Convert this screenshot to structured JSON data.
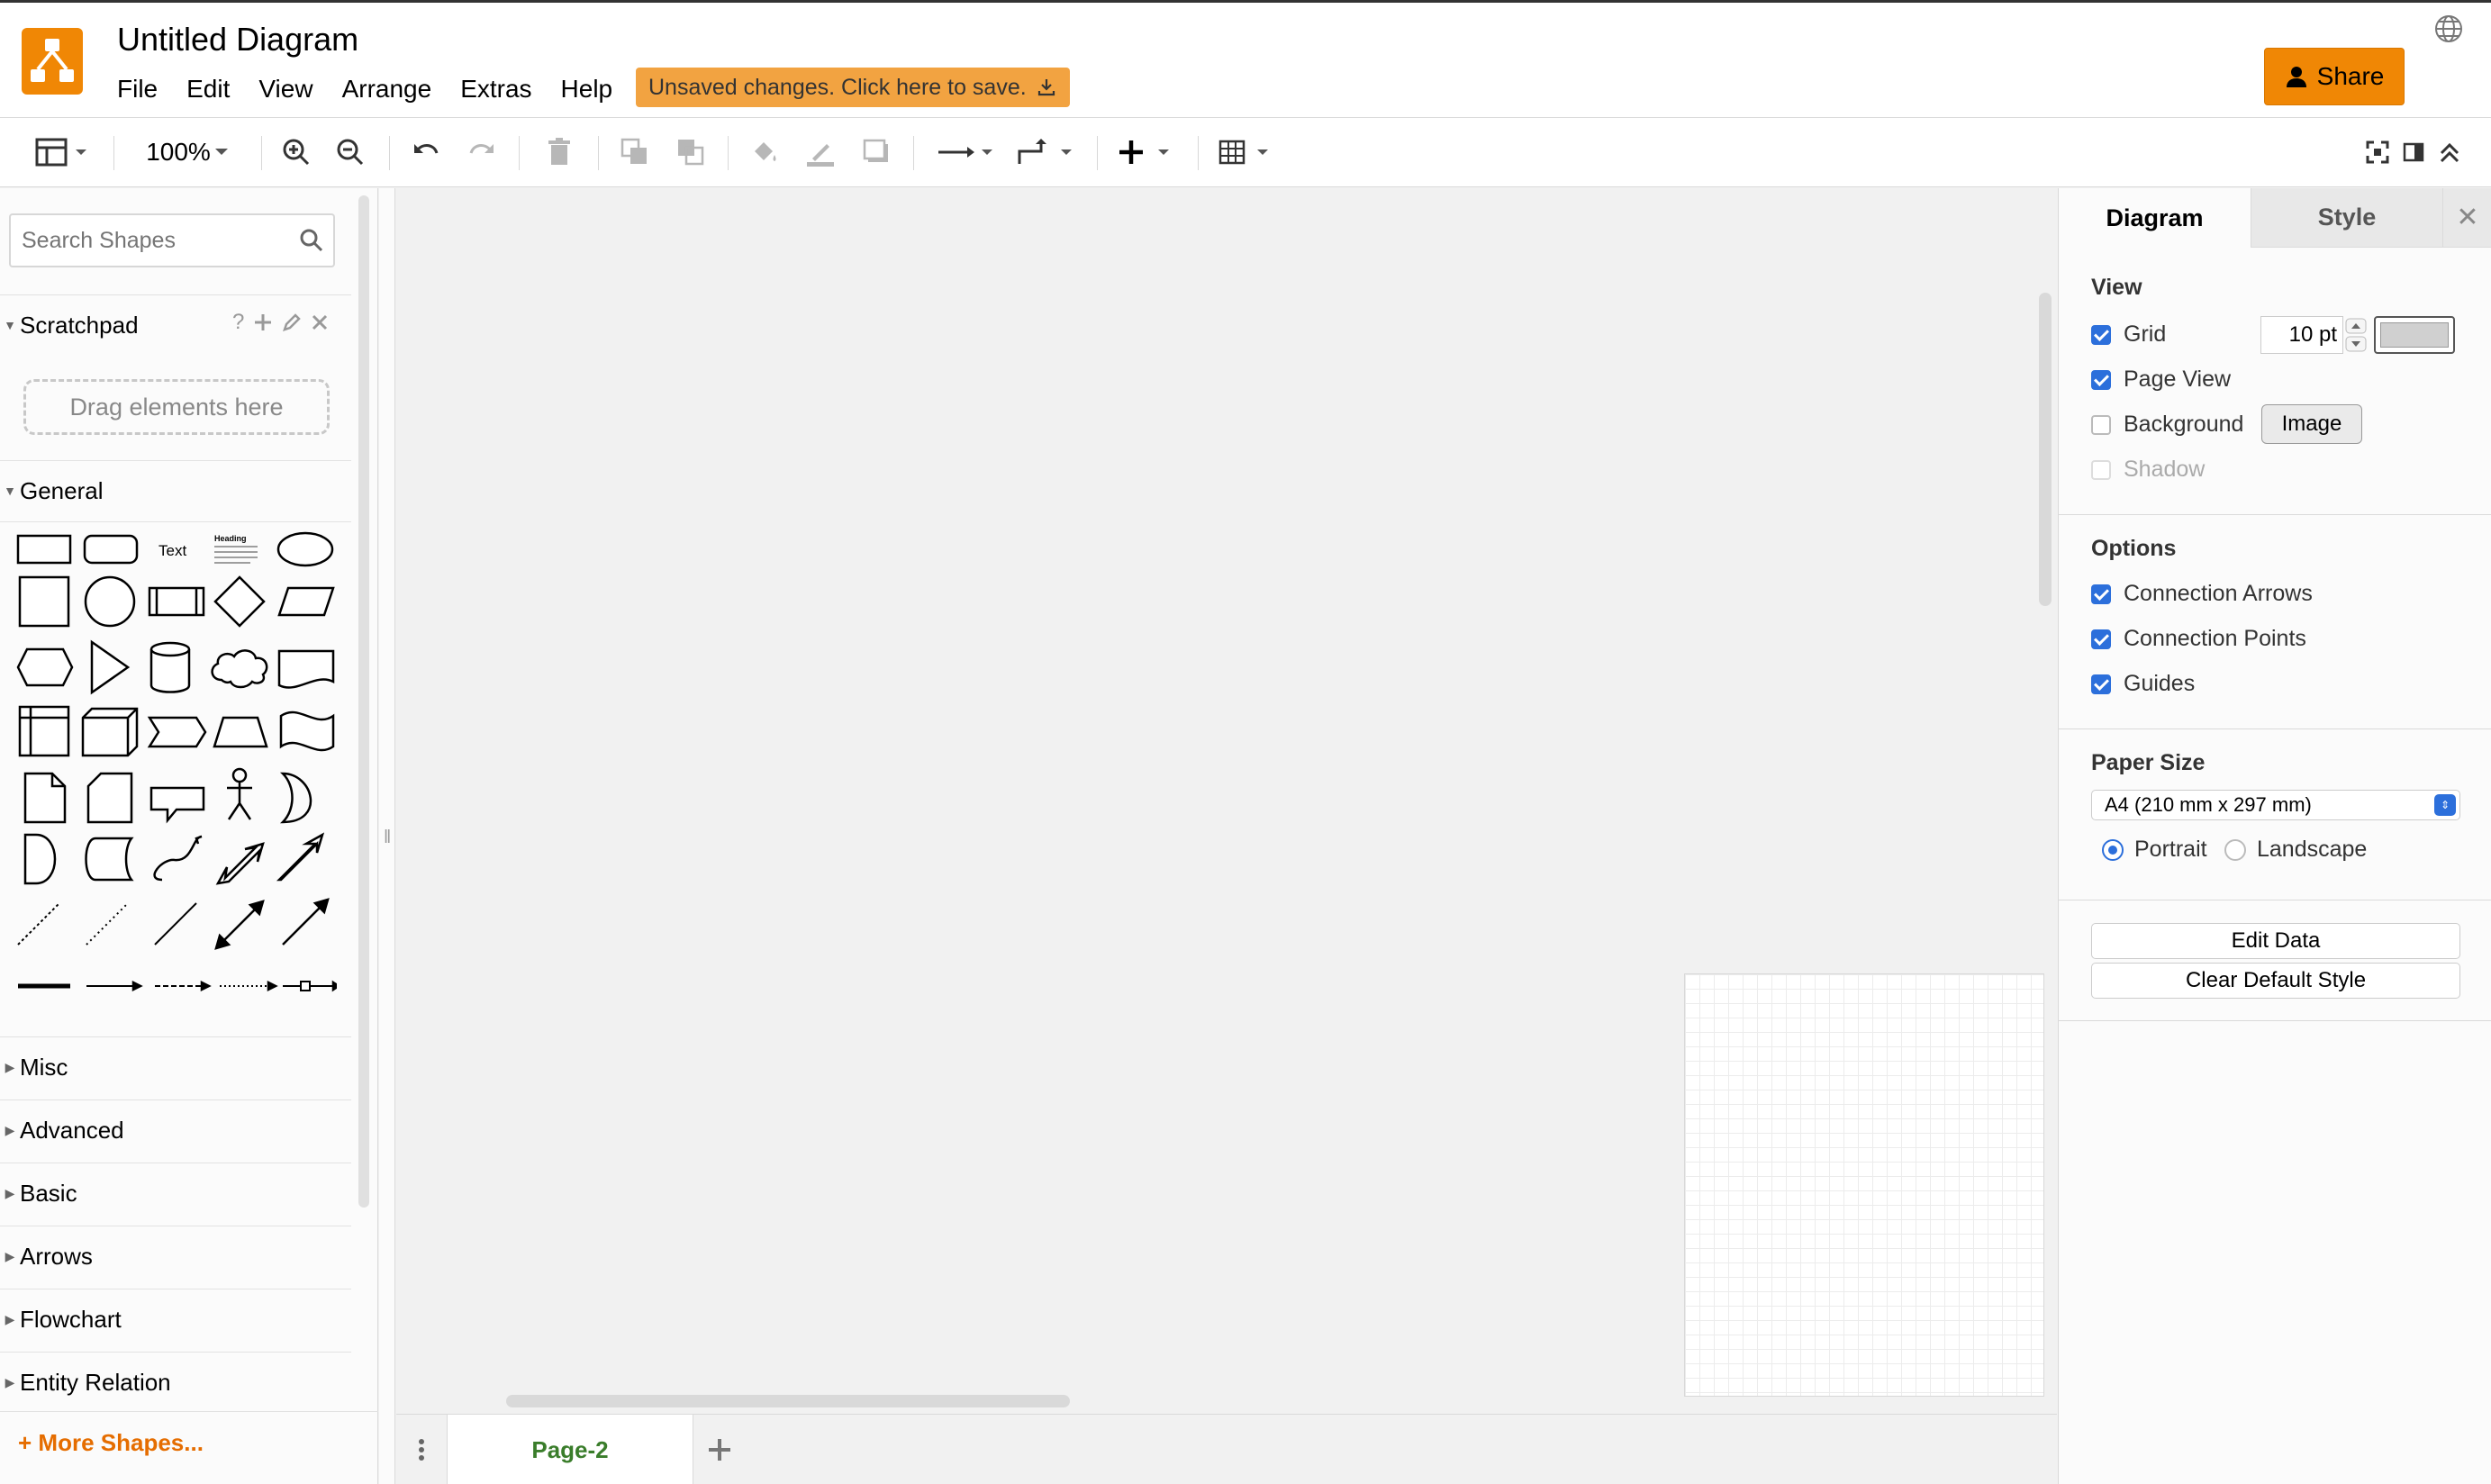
{
  "app": {
    "title": "Untitled Diagram",
    "unsaved_notice": "Unsaved changes. Click here to save.",
    "share_label": "Share",
    "brand_color": "#f08705"
  },
  "menu": [
    "File",
    "Edit",
    "View",
    "Arrange",
    "Extras",
    "Help"
  ],
  "toolbar": {
    "zoom": "100%",
    "icons": [
      "format-panel-icon",
      "zoom-in-icon",
      "zoom-out-icon",
      "undo-icon",
      "redo-icon",
      "delete-icon",
      "to-front-icon",
      "to-back-icon",
      "fill-color-icon",
      "line-color-icon",
      "shadow-icon",
      "connection-icon",
      "waypoints-icon",
      "insert-icon",
      "table-icon",
      "fullscreen-icon",
      "toggle-panel-icon",
      "collapse-icon"
    ]
  },
  "sidebar": {
    "search_placeholder": "Search Shapes",
    "scratchpad": {
      "label": "Scratchpad",
      "help": "?",
      "drop_hint": "Drag elements here"
    },
    "general_label": "General",
    "shape_text_label": "Text",
    "shape_heading_label": "Heading",
    "libraries": [
      "Misc",
      "Advanced",
      "Basic",
      "Arrows",
      "Flowchart",
      "Entity Relation"
    ],
    "more_shapes": "More Shapes..."
  },
  "pages": {
    "current": "Page-2"
  },
  "format_panel": {
    "tabs": [
      "Diagram",
      "Style"
    ],
    "view": {
      "title": "View",
      "grid_label": "Grid",
      "grid_checked": true,
      "grid_size": "10 pt",
      "page_view_label": "Page View",
      "page_view_checked": true,
      "background_label": "Background",
      "background_checked": false,
      "image_button": "Image",
      "shadow_label": "Shadow",
      "shadow_checked": false
    },
    "options": {
      "title": "Options",
      "connection_arrows": "Connection Arrows",
      "connection_points": "Connection Points",
      "guides": "Guides"
    },
    "paper": {
      "title": "Paper Size",
      "selected": "A4 (210 mm x 297 mm)",
      "portrait": "Portrait",
      "landscape": "Landscape",
      "orientation": "portrait"
    },
    "buttons": {
      "edit_data": "Edit Data",
      "clear_default_style": "Clear Default Style"
    }
  }
}
